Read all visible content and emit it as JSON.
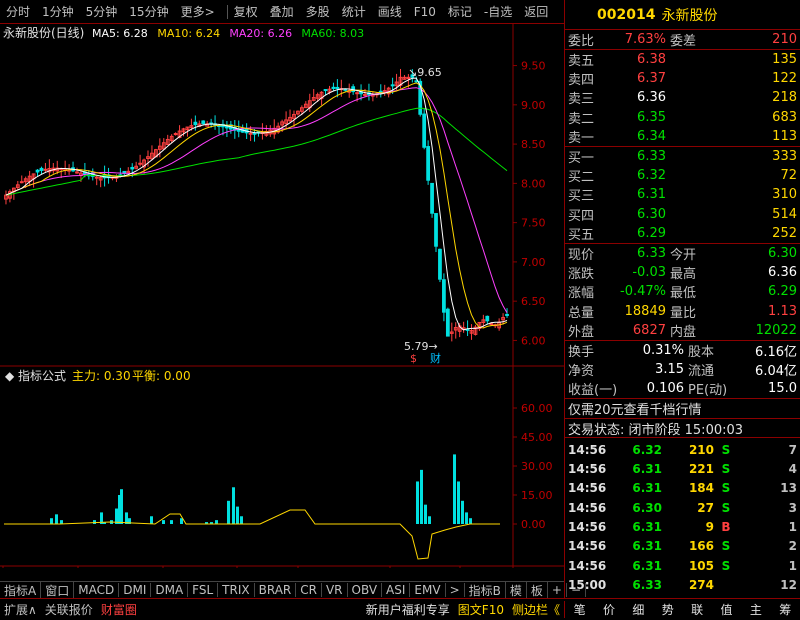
{
  "toolbar": {
    "items": [
      "分时",
      "1分钟",
      "5分钟",
      "15分钟",
      "更多>",
      "复权",
      "叠加",
      "多股",
      "统计",
      "画线",
      "F10",
      "标记",
      "-自选",
      "返回"
    ]
  },
  "stock": {
    "code": "002014",
    "name": "永新股份"
  },
  "chart": {
    "title": "永新股份(日线)",
    "ma": [
      {
        "label": "MA5: 6.28",
        "color": "#ffffff"
      },
      {
        "label": "MA10: 6.24",
        "color": "#ffd700"
      },
      {
        "label": "MA20: 6.26",
        "color": "#ff40ff"
      },
      {
        "label": "MA60: 8.03",
        "color": "#00e000"
      }
    ],
    "price_ticks": [
      "9.50",
      "9.00",
      "8.50",
      "8.00",
      "7.50",
      "7.00",
      "6.50",
      "6.00"
    ],
    "high_label": "9.65",
    "low_label": "5.79",
    "ind_title": "指标公式",
    "ind_main": "主力: 0.30",
    "ind_balance": "平衡: 0.00",
    "ind_ticks": [
      "60.00",
      "45.00",
      "30.00",
      "15.00",
      "0.00"
    ],
    "date_labels": [
      "2021年",
      "12",
      "1",
      "2",
      "3",
      "4",
      "5"
    ],
    "period": "日线",
    "markers": {
      "s": "$",
      "cai": "财"
    }
  },
  "chart_data": {
    "type": "candlestick",
    "ylim": [
      5.7,
      9.8
    ],
    "ma_last": {
      "MA5": 6.28,
      "MA10": 6.24,
      "MA20": 6.26,
      "MA60": 8.03
    }
  },
  "book": {
    "wb": {
      "label": "委比",
      "value": "7.63%",
      "label2": "委差",
      "value2": "210"
    },
    "sells": [
      {
        "l": "卖五",
        "p": "6.38",
        "q": "135"
      },
      {
        "l": "卖四",
        "p": "6.37",
        "q": "122"
      },
      {
        "l": "卖三",
        "p": "6.36",
        "q": "218"
      },
      {
        "l": "卖二",
        "p": "6.35",
        "q": "683"
      },
      {
        "l": "卖一",
        "p": "6.34",
        "q": "113"
      }
    ],
    "buys": [
      {
        "l": "买一",
        "p": "6.33",
        "q": "333"
      },
      {
        "l": "买二",
        "p": "6.32",
        "q": "72"
      },
      {
        "l": "买三",
        "p": "6.31",
        "q": "310"
      },
      {
        "l": "买四",
        "p": "6.30",
        "q": "514"
      },
      {
        "l": "买五",
        "p": "6.29",
        "q": "252"
      }
    ]
  },
  "quote": [
    {
      "l": "现价",
      "v": "6.33",
      "vc": "g",
      "l2": "今开",
      "v2": "6.30",
      "v2c": "g"
    },
    {
      "l": "涨跌",
      "v": "-0.03",
      "vc": "g",
      "l2": "最高",
      "v2": "6.36",
      "v2c": "w"
    },
    {
      "l": "涨幅",
      "v": "-0.47%",
      "vc": "g",
      "l2": "最低",
      "v2": "6.29",
      "v2c": "g"
    },
    {
      "l": "总量",
      "v": "18849",
      "vc": "y",
      "l2": "量比",
      "v2": "1.13",
      "v2c": "r"
    },
    {
      "l": "外盘",
      "v": "6827",
      "vc": "r",
      "l2": "内盘",
      "v2": "12022",
      "v2c": "g"
    }
  ],
  "fin": [
    {
      "l": "换手",
      "v": "0.31%",
      "l2": "股本",
      "v2": "6.16亿"
    },
    {
      "l": "净资",
      "v": "3.15",
      "l2": "流通",
      "v2": "6.04亿"
    },
    {
      "l": "收益(一)",
      "v": "0.106",
      "l2": "PE(动)",
      "v2": "15.0"
    }
  ],
  "promo": "仅需20元查看千档行情",
  "status": "交易状态: 闭市阶段 15:00:03",
  "ticks": [
    {
      "t": "14:56",
      "p": "6.32",
      "pc": "g",
      "v": "210",
      "d": "S",
      "dc": "g",
      "n": "7"
    },
    {
      "t": "14:56",
      "p": "6.31",
      "pc": "g",
      "v": "221",
      "d": "S",
      "dc": "g",
      "n": "4"
    },
    {
      "t": "14:56",
      "p": "6.31",
      "pc": "g",
      "v": "184",
      "d": "S",
      "dc": "g",
      "n": "13"
    },
    {
      "t": "14:56",
      "p": "6.30",
      "pc": "g",
      "v": "27",
      "d": "S",
      "dc": "g",
      "n": "3"
    },
    {
      "t": "14:56",
      "p": "6.31",
      "pc": "g",
      "v": "9",
      "d": "B",
      "dc": "r",
      "n": "1"
    },
    {
      "t": "14:56",
      "p": "6.31",
      "pc": "g",
      "v": "166",
      "d": "S",
      "dc": "g",
      "n": "2"
    },
    {
      "t": "14:56",
      "p": "6.31",
      "pc": "g",
      "v": "105",
      "d": "S",
      "dc": "g",
      "n": "1"
    },
    {
      "t": "15:00",
      "p": "6.33",
      "pc": "g",
      "v": "274",
      "d": "",
      "dc": "g",
      "n": "12"
    }
  ],
  "ind_tabs": [
    "指标A",
    "窗口",
    "MACD",
    "DMI",
    "DMA",
    "FSL",
    "TRIX",
    "BRAR",
    "CR",
    "VR",
    "OBV",
    "ASI",
    "EMV",
    ">",
    "指标B",
    "模",
    "板",
    "+",
    "−"
  ],
  "bottom": {
    "left": [
      "扩展∧",
      "关联报价",
      "财富圈"
    ],
    "mid": "新用户福利专享",
    "right": [
      "图文F10",
      "侧边栏《"
    ],
    "side": [
      "笔",
      "价",
      "细",
      "势",
      "联",
      "值",
      "主",
      "筹"
    ]
  }
}
